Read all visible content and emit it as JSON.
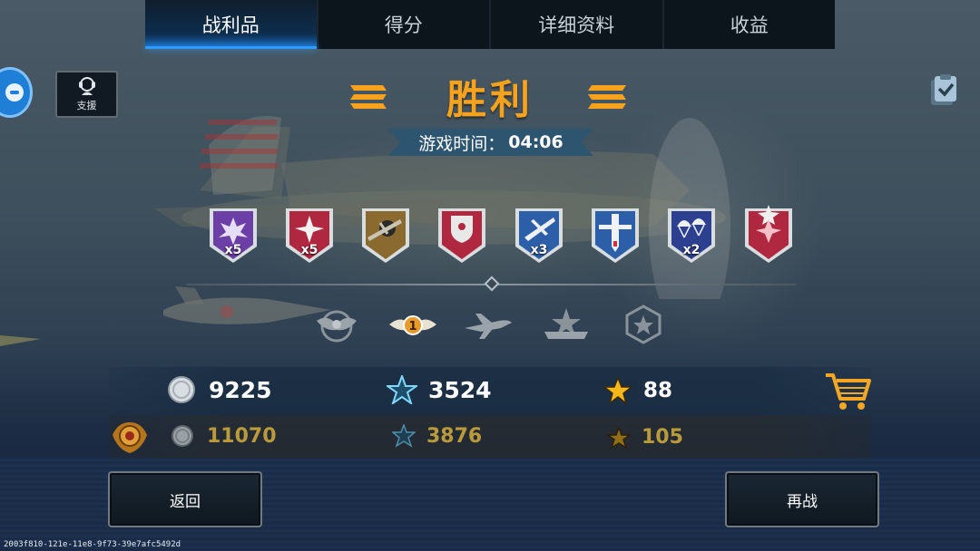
{
  "tabs": [
    {
      "label": "战利品",
      "active": true
    },
    {
      "label": "得分",
      "active": false
    },
    {
      "label": "详细资料",
      "active": false
    },
    {
      "label": "收益",
      "active": false
    }
  ],
  "support": {
    "label": "支援"
  },
  "result": {
    "title": "胜利",
    "time_label": "游戏时间：",
    "time_value": "04:06"
  },
  "medals": [
    {
      "icon": "explosion-medal-icon",
      "color": "#6b3fa6",
      "multiplier": "x5"
    },
    {
      "icon": "star-medal-icon",
      "color": "#b0283f",
      "multiplier": "x5"
    },
    {
      "icon": "crashed-plane-medal-icon",
      "color": "#8a6a2e",
      "multiplier": ""
    },
    {
      "icon": "shield-medal-icon",
      "color": "#b0283f",
      "multiplier": ""
    },
    {
      "icon": "plane-medal-icon",
      "color": "#2d5ea8",
      "multiplier": "x3"
    },
    {
      "icon": "diving-plane-medal-icon",
      "color": "#2d5ea8",
      "multiplier": ""
    },
    {
      "icon": "parachute-medal-icon",
      "color": "#2d3f8f",
      "multiplier": "x2"
    },
    {
      "icon": "double-star-medal-icon",
      "color": "#b0283f",
      "multiplier": ""
    }
  ],
  "ranks": [
    {
      "icon": "eagle-rank-icon"
    },
    {
      "icon": "wing-1-rank-icon"
    },
    {
      "icon": "plane-rank-icon"
    },
    {
      "icon": "star-ribbon-rank-icon"
    },
    {
      "icon": "hex-star-rank-icon"
    }
  ],
  "rewards": {
    "silver": "9225",
    "xp": "3524",
    "gold": "88"
  },
  "premium_rewards": {
    "silver": "11070",
    "xp": "3876",
    "gold": "105"
  },
  "buttons": {
    "back": "返回",
    "again": "再战"
  },
  "footer_id": "2003f810-121e-11e8-9f73-39e7afc5492d",
  "colors": {
    "accent_orange": "#f6a21c",
    "tab_active": "#1b6fc6",
    "premium_text": "#b99b3c"
  }
}
